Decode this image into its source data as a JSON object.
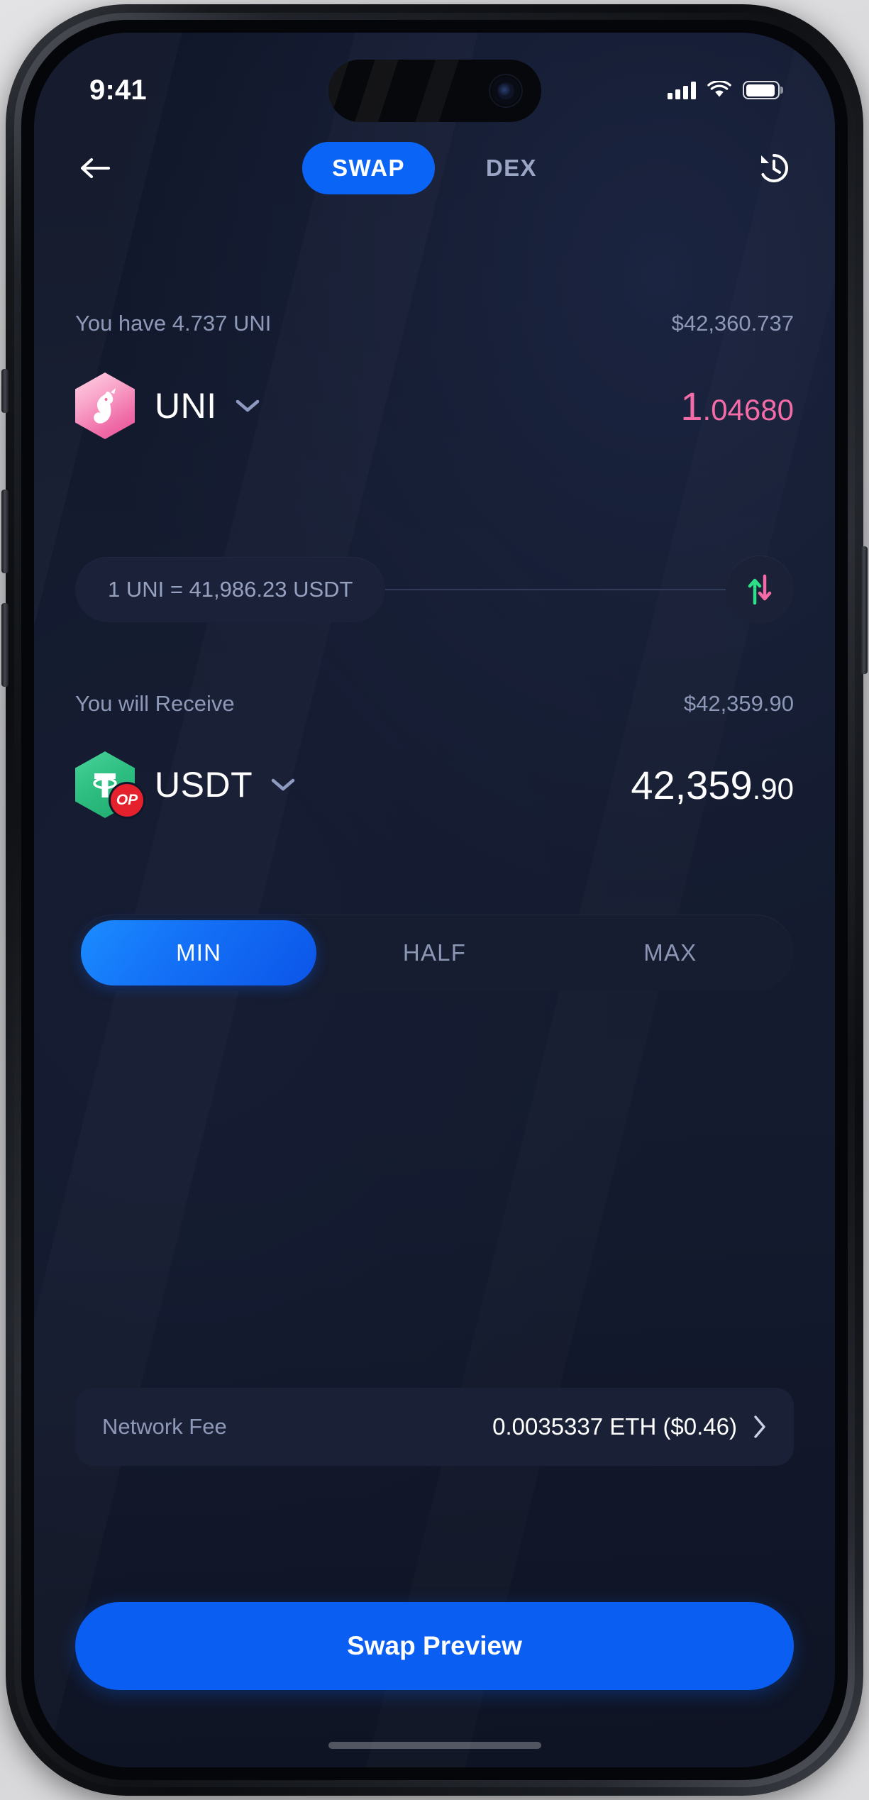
{
  "status_bar": {
    "time": "9:41",
    "signal_icon": "cellular-signal-icon",
    "wifi_icon": "wifi-icon",
    "battery_icon": "battery-icon"
  },
  "navbar": {
    "back_icon": "back-arrow-icon",
    "history_icon": "history-clock-icon",
    "tabs": [
      {
        "label": "SWAP",
        "active": true
      },
      {
        "label": "DEX",
        "active": false
      }
    ]
  },
  "from_section": {
    "balance_label": "You have 4.737 UNI",
    "fiat_value": "$42,360.737",
    "token_symbol": "UNI",
    "token_icon": "uni-unicorn-icon",
    "chevron_icon": "chevron-down-icon",
    "amount_int": "1",
    "amount_dec": ".04680"
  },
  "rate_row": {
    "rate_text": "1 UNI = 41,986.23 USDT",
    "swap_icon": "swap-vertical-arrows-icon"
  },
  "to_section": {
    "receive_label": "You will Receive",
    "fiat_value": "$42,359.90",
    "token_symbol": "USDT",
    "token_icon": "tether-icon",
    "network_badge": "OP",
    "chevron_icon": "chevron-down-icon",
    "amount_int": "42,359",
    "amount_dec": ".90"
  },
  "amount_presets": [
    {
      "label": "MIN",
      "active": true
    },
    {
      "label": "HALF",
      "active": false
    },
    {
      "label": "MAX",
      "active": false
    }
  ],
  "network_fee": {
    "label": "Network Fee",
    "value": "0.0035337 ETH ($0.46)",
    "chevron_icon": "chevron-right-icon"
  },
  "primary_action": {
    "label": "Swap Preview"
  },
  "colors": {
    "accent_blue": "#0a5ff2",
    "uni_pink": "#f36ca8",
    "usdt_green": "#2fbf83",
    "op_red": "#e5212e",
    "muted_text": "#8e99b8",
    "screen_bg": "#141b2f"
  }
}
